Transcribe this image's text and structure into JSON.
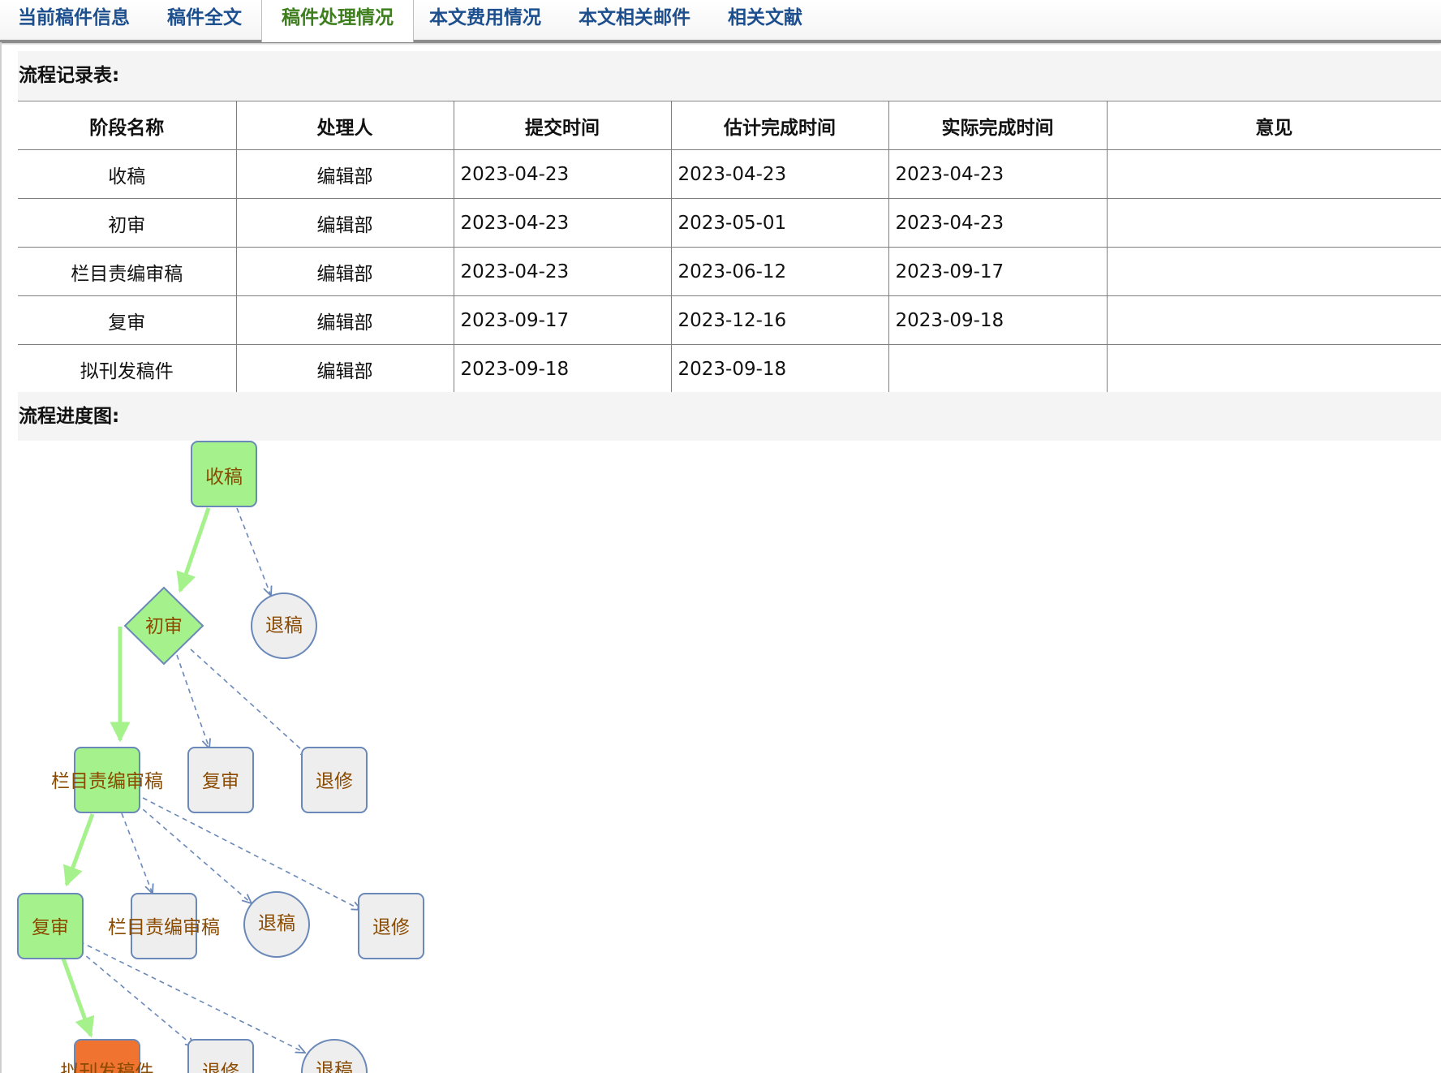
{
  "tabs": [
    {
      "label": "当前稿件信息",
      "active": false
    },
    {
      "label": "稿件全文",
      "active": false
    },
    {
      "label": "稿件处理情况",
      "active": true
    },
    {
      "label": "本文费用情况",
      "active": false
    },
    {
      "label": "本文相关邮件",
      "active": false
    },
    {
      "label": "相关文献",
      "active": false
    }
  ],
  "record_section": {
    "title": "流程记录表:"
  },
  "record_table": {
    "headers": [
      "阶段名称",
      "处理人",
      "提交时间",
      "估计完成时间",
      "实际完成时间",
      "意见"
    ],
    "rows": [
      [
        "收稿",
        "编辑部",
        "2023-04-23",
        "2023-04-23",
        "2023-04-23",
        ""
      ],
      [
        "初审",
        "编辑部",
        "2023-04-23",
        "2023-05-01",
        "2023-04-23",
        ""
      ],
      [
        "栏目责编审稿",
        "编辑部",
        "2023-04-23",
        "2023-06-12",
        "2023-09-17",
        ""
      ],
      [
        "复审",
        "编辑部",
        "2023-09-17",
        "2023-12-16",
        "2023-09-18",
        ""
      ],
      [
        "拟刊发稿件",
        "编辑部",
        "2023-09-18",
        "2023-09-18",
        "",
        ""
      ]
    ]
  },
  "progress_section": {
    "title": "流程进度图:"
  },
  "flow": {
    "colors": {
      "done": "#a5f28c",
      "current": "#f07430",
      "pending": "#eeeeee",
      "stroke": "#6a88b8",
      "arrow": "#a5f28c",
      "dashed": "#6a88b8",
      "label": "#8a4a00"
    },
    "nodes": [
      {
        "id": "n1",
        "label": "收稿",
        "shape": "rect",
        "status": "done"
      },
      {
        "id": "n2",
        "label": "初审",
        "shape": "diamond",
        "status": "done"
      },
      {
        "id": "n3",
        "label": "退稿",
        "shape": "circle",
        "status": "pending"
      },
      {
        "id": "n4",
        "label": "栏目责编审稿",
        "shape": "rect",
        "status": "done"
      },
      {
        "id": "n5",
        "label": "复审",
        "shape": "rect",
        "status": "pending"
      },
      {
        "id": "n6",
        "label": "退修",
        "shape": "rect",
        "status": "pending"
      },
      {
        "id": "n7",
        "label": "复审",
        "shape": "rect",
        "status": "done"
      },
      {
        "id": "n8",
        "label": "栏目责编审稿",
        "shape": "rect",
        "status": "pending"
      },
      {
        "id": "n9",
        "label": "退稿",
        "shape": "circle",
        "status": "pending"
      },
      {
        "id": "n10",
        "label": "退修",
        "shape": "rect",
        "status": "pending"
      },
      {
        "id": "n11",
        "label": "拟刊发稿件",
        "shape": "rect",
        "status": "current"
      },
      {
        "id": "n12",
        "label": "退修",
        "shape": "rect",
        "status": "pending"
      },
      {
        "id": "n13",
        "label": "退稿",
        "shape": "circle",
        "status": "pending"
      }
    ]
  }
}
